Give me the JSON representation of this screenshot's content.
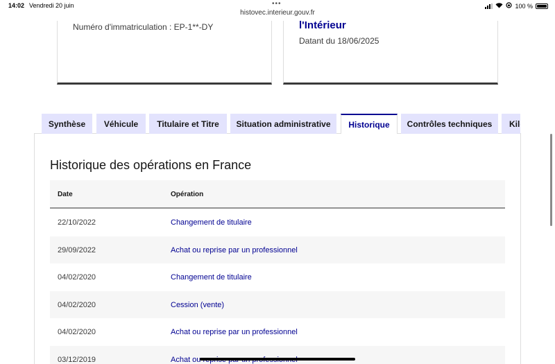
{
  "status_bar": {
    "time": "14:02",
    "date": "Vendredi 20 juin",
    "battery": "100 %"
  },
  "browser": {
    "url": "histovec.interieur.gouv.fr"
  },
  "cards": {
    "left_plate": "Numéro d'immatriculation : EP-1**-DY",
    "right_issuer": "l'Intérieur",
    "right_dated": "Datant du 18/06/2025"
  },
  "tabs": [
    {
      "label": "Synthèse",
      "active": false
    },
    {
      "label": "Véhicule",
      "active": false
    },
    {
      "label": "Titulaire et Titre",
      "active": false
    },
    {
      "label": "Situation administrative",
      "active": false
    },
    {
      "label": "Historique",
      "active": true
    },
    {
      "label": "Contrôles techniques",
      "active": false
    },
    {
      "label": "Kilo",
      "active": false
    }
  ],
  "panel": {
    "title": "Historique des opérations en France",
    "columns": [
      "Date",
      "Opération"
    ],
    "rows": [
      {
        "date": "22/10/2022",
        "operation": "Changement de titulaire"
      },
      {
        "date": "29/09/2022",
        "operation": "Achat ou reprise par un professionnel"
      },
      {
        "date": "04/02/2020",
        "operation": "Changement de titulaire"
      },
      {
        "date": "04/02/2020",
        "operation": "Cession (vente)"
      },
      {
        "date": "04/02/2020",
        "operation": "Achat ou reprise par un professionnel"
      },
      {
        "date": "03/12/2019",
        "operation": "Achat ou reprise par un professionnel"
      }
    ]
  },
  "colors": {
    "accent": "#000091",
    "tab_bg": "#e3e3fd",
    "row_alt": "#f6f6f6"
  }
}
